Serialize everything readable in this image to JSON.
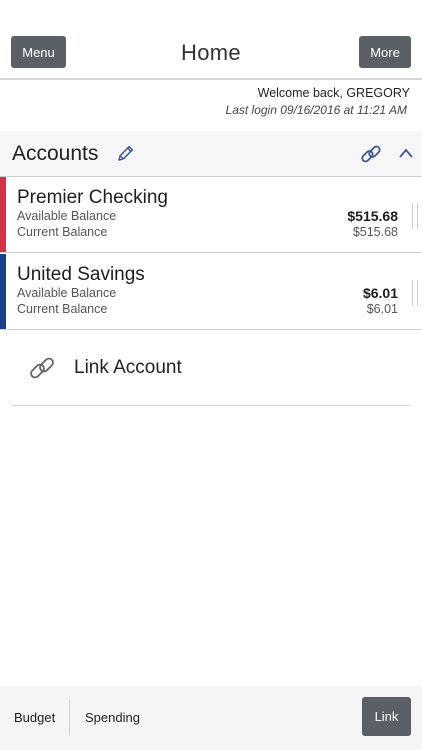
{
  "header": {
    "menu_label": "Menu",
    "title": "Home",
    "more_label": "More"
  },
  "welcome": {
    "greeting": "Welcome back, GREGORY",
    "last_login": "Last login 09/16/2016 at 11:21 AM"
  },
  "accounts_section": {
    "title": "Accounts",
    "icons": {
      "edit": "pencil-icon",
      "link": "link-icon",
      "collapse": "chevron-up-icon"
    }
  },
  "accounts": [
    {
      "name": "Premier Checking",
      "available_label": "Available Balance",
      "available_value": "$515.68",
      "current_label": "Current Balance",
      "current_value": "$515.68",
      "accent_color": "#d0334a"
    },
    {
      "name": "United Savings",
      "available_label": "Available Balance",
      "available_value": "$6.01",
      "current_label": "Current Balance",
      "current_value": "$6.01",
      "accent_color": "#1c3f8c"
    }
  ],
  "link_account": {
    "label": "Link Account",
    "icon": "link-icon"
  },
  "footer": {
    "tabs": [
      "Budget",
      "Spending"
    ],
    "link_button": "Link"
  },
  "colors": {
    "button_bg": "#5b6066",
    "section_bg": "#f7f7f9",
    "icon_blue": "#3d5a8a"
  }
}
